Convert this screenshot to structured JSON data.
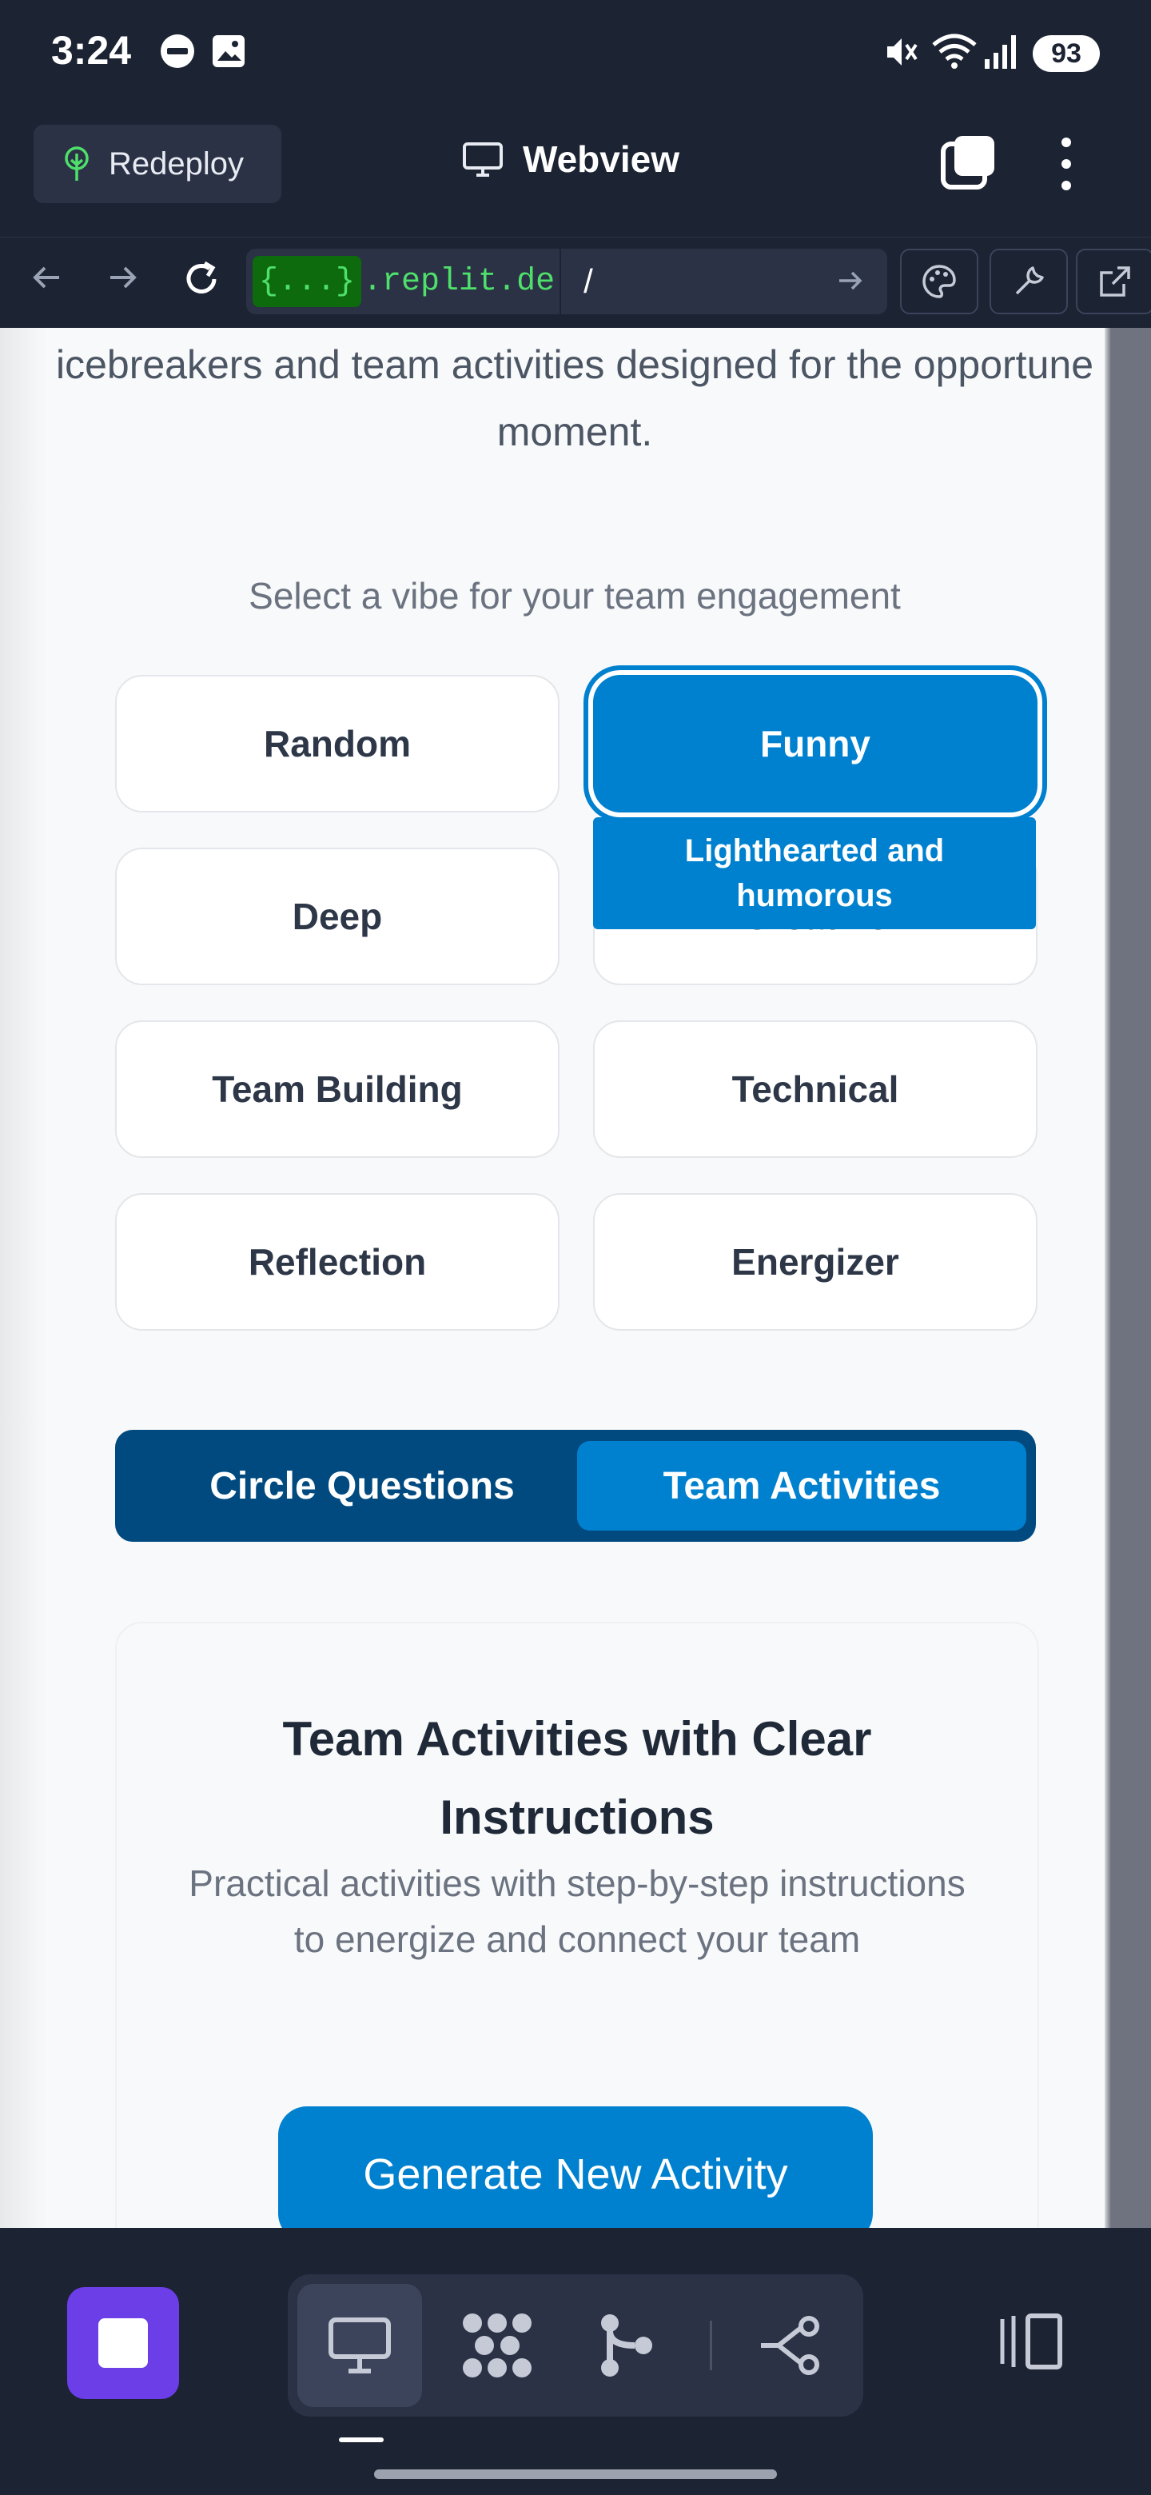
{
  "status_bar": {
    "time": "3:24",
    "battery": "93"
  },
  "top_bar": {
    "redeploy_label": "Redeploy",
    "title": "Webview"
  },
  "url_bar": {
    "host_chip": "{...}",
    "host": ".replit.de",
    "path": "/"
  },
  "app": {
    "intro_text": "icebreakers and team activities designed for the opportune moment.",
    "vibe_prompt": "Select a vibe for your team engagement",
    "vibes": [
      {
        "label": "Random",
        "selected": false
      },
      {
        "label": "Funny",
        "selected": true
      },
      {
        "label": "Deep",
        "selected": false
      },
      {
        "label": "Creative",
        "selected": false
      },
      {
        "label": "Team Building",
        "selected": false
      },
      {
        "label": "Technical",
        "selected": false
      },
      {
        "label": "Reflection",
        "selected": false
      },
      {
        "label": "Energizer",
        "selected": false
      }
    ],
    "vibe_tooltip": "Lighthearted and humorous",
    "mode_toggle": {
      "options": [
        "Circle Questions",
        "Team Activities"
      ],
      "selected": "Team Activities"
    },
    "activity_card": {
      "title": "Team Activities with Clear Instructions",
      "description": "Practical activities with step-by-step instructions to energize and connect your team"
    },
    "generate_button": "Generate New Activity"
  },
  "bottom_bar": {
    "tabs": [
      "monitor-icon",
      "nodes-icon",
      "branch-icon",
      "share-icon"
    ],
    "active_tab": "monitor-icon"
  },
  "colors": {
    "primary": "#0081cf",
    "toggle_bg": "#004a80",
    "replit_dark": "#1c2333",
    "stop_purple": "#6b3ee8"
  }
}
